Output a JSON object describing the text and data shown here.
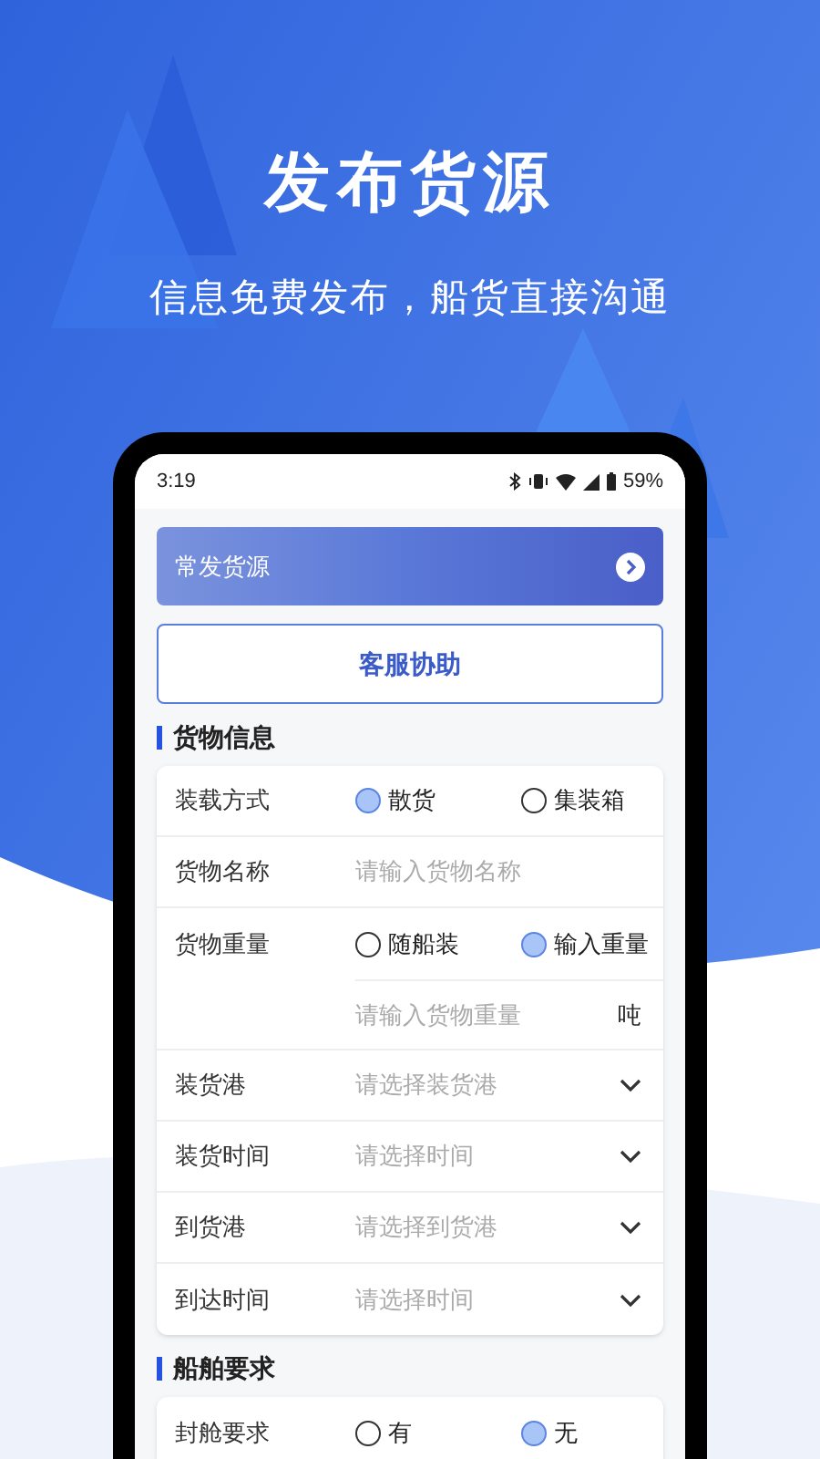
{
  "headline": "发布货源",
  "subtitle": "信息免费发布，船货直接沟通",
  "status_bar": {
    "time": "3:19",
    "battery": "59%"
  },
  "banner": {
    "label": "常发货源"
  },
  "help_button": {
    "label": "客服协助"
  },
  "sections": [
    {
      "title": "货物信息",
      "rows": [
        {
          "kind": "radio",
          "label": "装载方式",
          "options": [
            {
              "label": "散货",
              "selected": true
            },
            {
              "label": "集装箱",
              "selected": false
            }
          ]
        },
        {
          "kind": "input",
          "label": "货物名称",
          "placeholder": "请输入货物名称"
        },
        {
          "kind": "radio",
          "label": "货物重量",
          "options": [
            {
              "label": "随船装",
              "selected": false
            },
            {
              "label": "输入重量",
              "selected": true
            }
          ]
        },
        {
          "kind": "unit",
          "placeholder": "请输入货物重量",
          "unit": "吨"
        },
        {
          "kind": "select",
          "label": "装货港",
          "placeholder": "请选择装货港"
        },
        {
          "kind": "select",
          "label": "装货时间",
          "placeholder": "请选择时间"
        },
        {
          "kind": "select",
          "label": "到货港",
          "placeholder": "请选择到货港"
        },
        {
          "kind": "select",
          "label": "到达时间",
          "placeholder": "请选择时间"
        }
      ]
    },
    {
      "title": "船舶要求",
      "rows": [
        {
          "kind": "radio",
          "label": "封舱要求",
          "options": [
            {
              "label": "有",
              "selected": false
            },
            {
              "label": "无",
              "selected": true
            }
          ]
        }
      ]
    }
  ]
}
